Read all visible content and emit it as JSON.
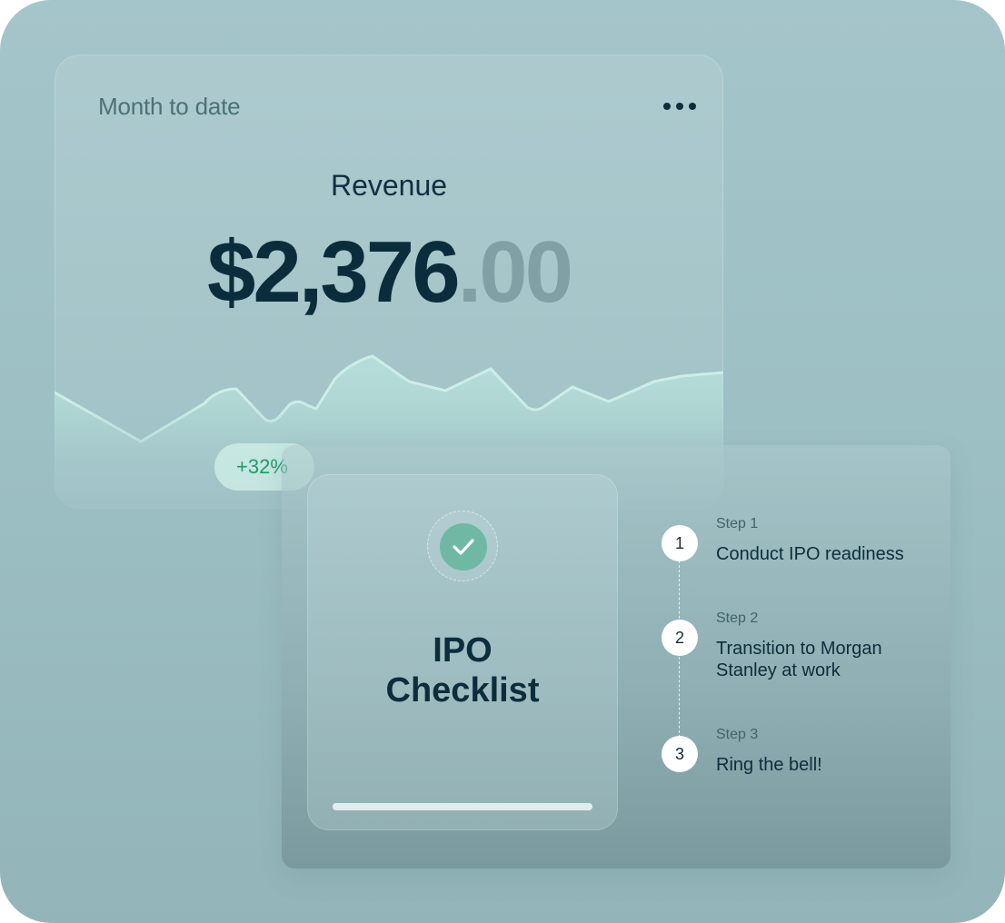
{
  "revenue_card": {
    "period_label": "Month to date",
    "more_icon": "more-horizontal-icon",
    "metric_label": "Revenue",
    "amount_whole": "$2,376",
    "amount_cents": ".00",
    "change_badge": "+32%"
  },
  "checklist": {
    "check_icon": "checkmark-icon",
    "title_line1": "IPO",
    "title_line2": "Checklist",
    "progress": 1.0,
    "steps": [
      {
        "number": "1",
        "label": "Step 1",
        "text": "Conduct IPO readiness"
      },
      {
        "number": "2",
        "label": "Step 2",
        "text": "Transition to Morgan Stanley at work"
      },
      {
        "number": "3",
        "label": "Step 3",
        "text": "Ring the bell!"
      }
    ]
  },
  "colors": {
    "background": "#a4c5ca",
    "text_dark": "#0b2c3b",
    "cents": "#7fa1a6",
    "positive": "#1f9d67",
    "check": "#6fb9a4"
  }
}
